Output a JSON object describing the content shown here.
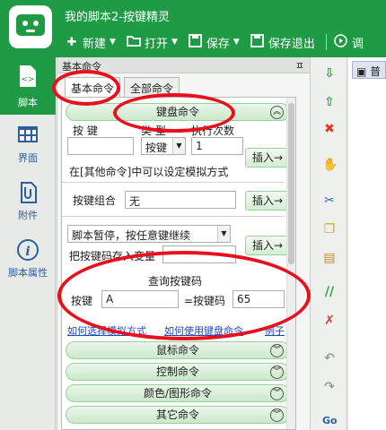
{
  "app": {
    "title": "我的脚本2-按键精灵"
  },
  "toolbar": {
    "new": "新建",
    "open": "打开",
    "save": "保存",
    "save_exit": "保存退出",
    "debug": "调"
  },
  "leftnav": {
    "items": [
      {
        "label": "脚本"
      },
      {
        "label": "界面"
      },
      {
        "label": "附件"
      },
      {
        "label": "脚本属性"
      }
    ]
  },
  "panel": {
    "title": "基本命令",
    "pin": "ㅍ",
    "tabs": [
      "基本命令",
      "全部命令"
    ],
    "keyboard": {
      "group_label": "键盘命令",
      "col_key": "按 键",
      "col_type": "类 型",
      "col_times": "执行次数",
      "key_value": "",
      "type_value": "按键",
      "times_value": "1",
      "insert": "插入→",
      "hint": "在[其他命令]中可以设定模拟方式",
      "combo_label": "按键组合",
      "combo_value": "无",
      "pause_value": "脚本暂停，按任意键继续",
      "store_label": "把按键码存入变量",
      "query_title": "查询按键码",
      "query_key_label": "按键",
      "query_key_value": "A",
      "query_code_label": "=按键码",
      "query_code_value": "65",
      "link_howto": "如何选择模拟方式",
      "link_use": "如何使用键盘命令",
      "link_example": "例子"
    },
    "groups": [
      "鼠标命令",
      "控制命令",
      "颜色/图形命令",
      "其它命令"
    ]
  },
  "editor": {
    "tab_label": "普"
  },
  "colors": {
    "brand_green": "#1f9a45",
    "annotation_red": "#e8101c"
  }
}
